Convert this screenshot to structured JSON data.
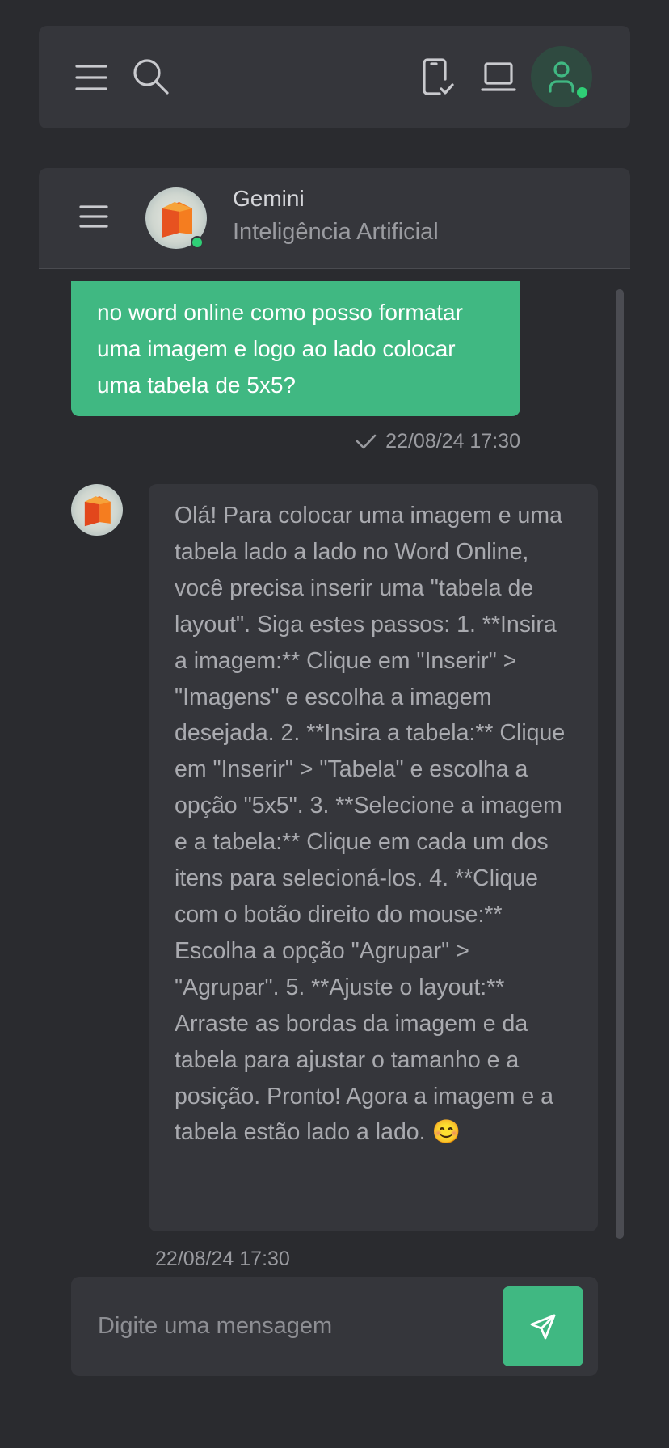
{
  "topbar": {
    "menu_icon": "hamburger-icon",
    "search_icon": "search-icon",
    "device_icon": "phone-check-icon",
    "desktop_icon": "laptop-icon",
    "profile_icon": "user-icon",
    "profile_status": "online"
  },
  "chat_header": {
    "menu_icon": "hamburger-icon",
    "name": "Gemini",
    "subtitle": "Inteligência Artificial",
    "status": "online"
  },
  "messages": [
    {
      "from": "user",
      "text": "no word online como posso formatar uma imagem e logo ao lado colocar uma tabela de 5x5?",
      "timestamp": "22/08/24 17:30",
      "status_icon": "check-icon"
    },
    {
      "from": "bot",
      "text": "Olá! Para colocar uma imagem e uma tabela lado a lado no Word Online, você precisa inserir uma \"tabela de layout\". Siga estes passos: 1. **Insira a imagem:** Clique em \"Inserir\" > \"Imagens\" e escolha a imagem desejada. 2. **Insira a tabela:** Clique em \"Inserir\" > \"Tabela\" e escolha a opção \"5x5\". 3. **Selecione a imagem e a tabela:** Clique em cada um dos itens para selecioná-los. 4. **Clique com o botão direito do mouse:** Escolha a opção \"Agrupar\" > \"Agrupar\". 5. **Ajuste o layout:** Arraste as bordas da imagem e da tabela para ajustar o tamanho e a posição. Pronto! Agora a imagem e a tabela estão lado a lado. 😊",
      "timestamp": "22/08/24 17:30"
    }
  ],
  "composer": {
    "placeholder": "Digite uma mensagem",
    "value": "",
    "send_icon": "send-icon"
  },
  "colors": {
    "background": "#2a2b2f",
    "panel": "#35363b",
    "accent": "#40b882",
    "online": "#2fcf76"
  }
}
